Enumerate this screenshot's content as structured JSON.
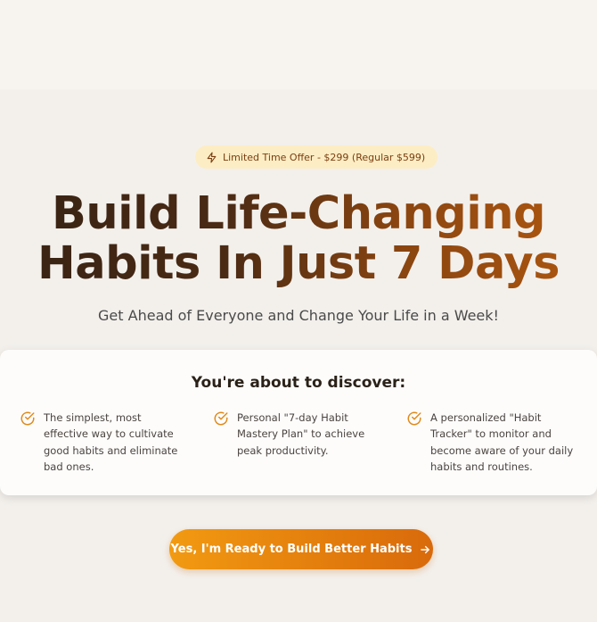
{
  "badge": {
    "icon": "lightning-icon",
    "text": "Limited Time Offer - $299 (Regular $599)"
  },
  "hero": {
    "headline_line1": "Build Life-Changing",
    "headline_line2": "Habits In Just 7 Days",
    "subhead": "Get Ahead of Everyone and Change Your Life in a Week!"
  },
  "discover": {
    "title": "You're about to discover:",
    "items": [
      {
        "icon": "check-circle-icon",
        "text": "The simplest, most effective way to cultivate good habits and eliminate bad ones."
      },
      {
        "icon": "check-circle-icon",
        "text": "Personal \"7-day Habit Mastery Plan\" to achieve peak productivity."
      },
      {
        "icon": "check-circle-icon",
        "text": "A personalized \"Habit Tracker\" to monitor and become aware of your daily habits and routines."
      }
    ]
  },
  "cta": {
    "label": "Yes, I'm Ready to Build Better Habits",
    "icon": "arrow-right-icon"
  },
  "colors": {
    "accent": "#e8870f",
    "badge_bg": "#fdedc4",
    "heading_dark": "#3b2414",
    "heading_warm": "#a85410"
  }
}
